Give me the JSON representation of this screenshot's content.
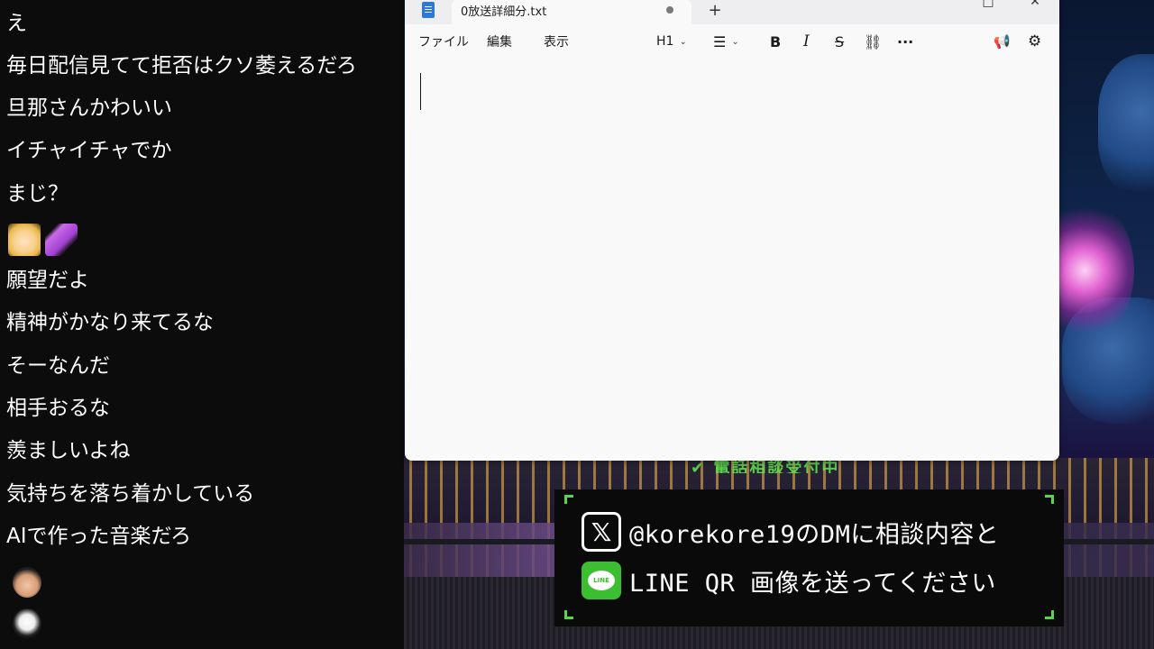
{
  "chat": {
    "messages": [
      "え",
      "毎日配信見てて拒否はクソ萎えるだろ",
      "旦那さんかわいい",
      "イチャイチャでか",
      "まじ？",
      "願望だよ",
      "精神がかなり来てるな",
      "そーなんだ",
      "相手おるな",
      "羨ましいよね",
      "気持ちを落ち着かしている",
      "AIで作った音楽だろ"
    ],
    "emotes": [
      "anime-girl-emote",
      "pink-hand-emote"
    ],
    "avatars": [
      "user-avatar",
      "user-avatar"
    ]
  },
  "notepad": {
    "tab_title": "0放送詳細分.txt",
    "new_tab": "+",
    "menu": [
      "ファイル",
      "編集",
      "表示"
    ],
    "heading_button": "H1",
    "bold": "B",
    "italic": "I",
    "strike": "S",
    "more": "···",
    "editor_text": ""
  },
  "overlay": {
    "banner": "✔ 電話相談受付中",
    "x_line": "@korekore19のDMに相談内容と",
    "line_line": "LINE QR 画像を送ってください",
    "x_icon_glyph": "𝕏",
    "line_icon_text": "LINE",
    "accent_green": "#58d64a"
  }
}
